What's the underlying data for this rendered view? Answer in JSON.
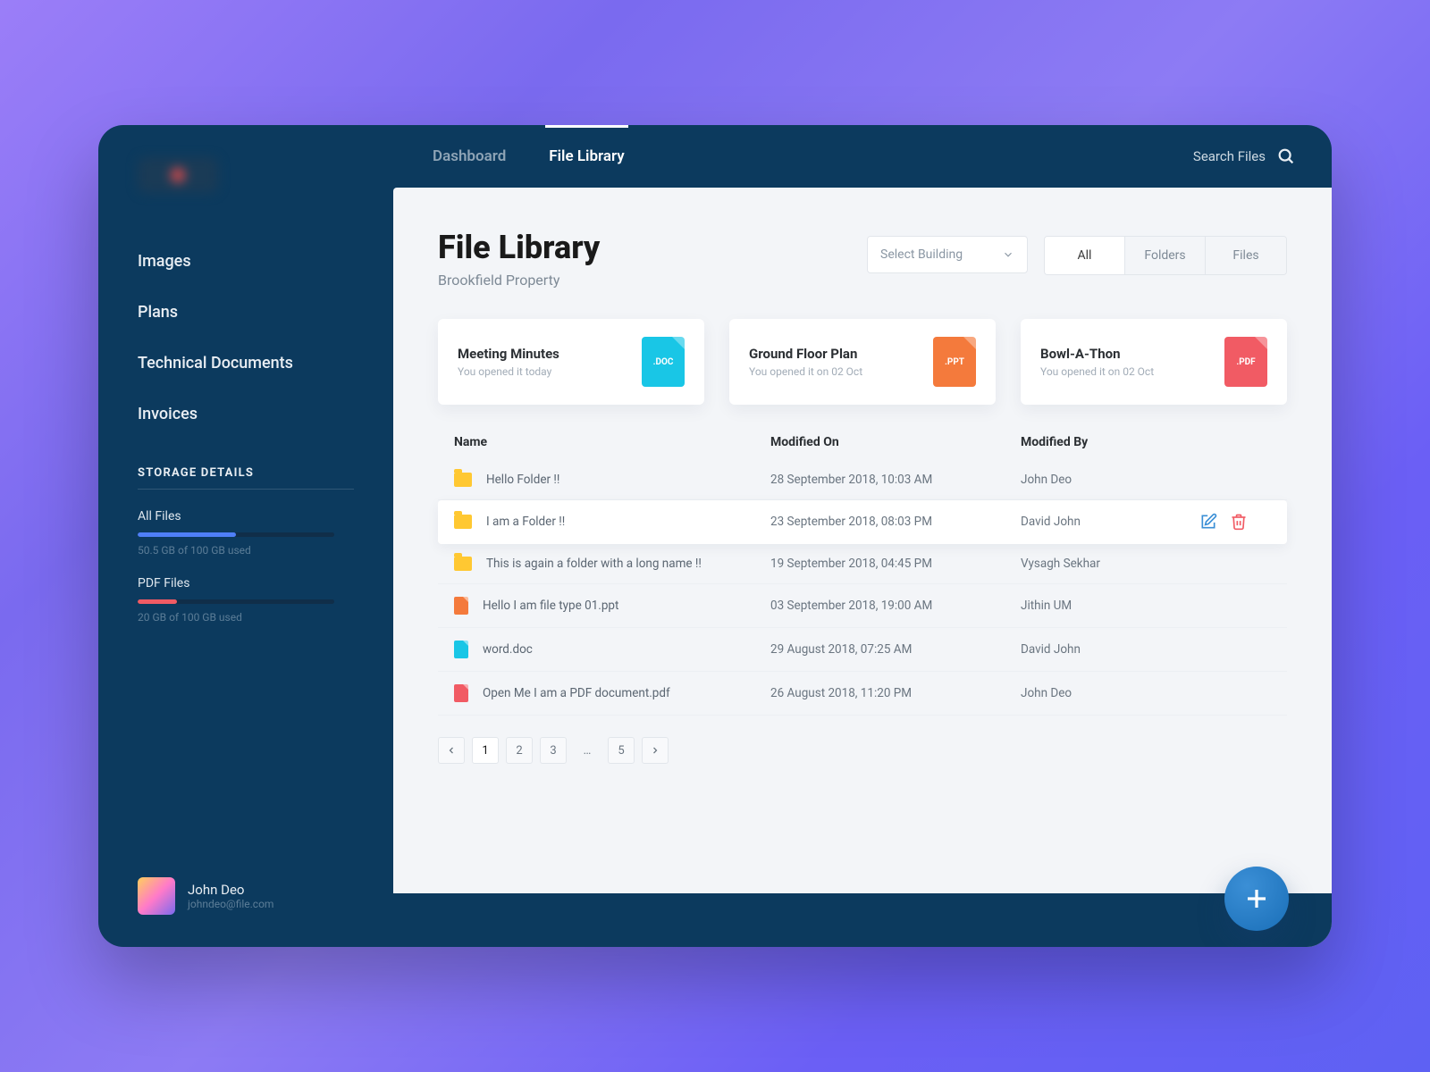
{
  "header": {
    "tabs": [
      {
        "label": "Dashboard",
        "active": false
      },
      {
        "label": "File Library",
        "active": true
      }
    ],
    "search_label": "Search Files"
  },
  "sidebar": {
    "nav": [
      {
        "label": "Images"
      },
      {
        "label": "Plans"
      },
      {
        "label": "Technical Documents"
      },
      {
        "label": "Invoices"
      }
    ],
    "storage_title": "STORAGE DETAILS",
    "storage": [
      {
        "label": "All Files",
        "meta": "50.5 GB of 100 GB used",
        "fill_pct": 50,
        "color": "#4f7ff7"
      },
      {
        "label": "PDF Files",
        "meta": "20 GB of 100 GB used",
        "fill_pct": 20,
        "color": "#f15b64"
      }
    ],
    "user": {
      "name": "John Deo",
      "email": "johndeo@file.com"
    }
  },
  "page": {
    "title": "File Library",
    "subtitle": "Brookfield Property",
    "select_placeholder": "Select Building",
    "filter_tabs": [
      {
        "label": "All",
        "active": true
      },
      {
        "label": "Folders",
        "active": false
      },
      {
        "label": "Files",
        "active": false
      }
    ]
  },
  "recent": [
    {
      "title": "Meeting Minutes",
      "sub": "You opened it today",
      "badge": ".DOC",
      "badge_class": "badge-doc"
    },
    {
      "title": "Ground Floor Plan",
      "sub": "You opened it on 02 Oct",
      "badge": ".PPT",
      "badge_class": "badge-ppt"
    },
    {
      "title": "Bowl-A-Thon",
      "sub": "You opened it on 02 Oct",
      "badge": ".PDF",
      "badge_class": "badge-pdf"
    }
  ],
  "columns": {
    "name": "Name",
    "modified_on": "Modified On",
    "modified_by": "Modified By"
  },
  "rows": [
    {
      "kind": "folder",
      "name": "Hello Folder !!",
      "modified_on": "28 September 2018, 10:03 AM",
      "modified_by": "John Deo",
      "selected": false
    },
    {
      "kind": "folder",
      "name": "I am a Folder !!",
      "modified_on": "23 September 2018, 08:03 PM",
      "modified_by": "David John",
      "selected": true
    },
    {
      "kind": "folder",
      "name": "This is again a folder with a long name !!",
      "modified_on": "19 September 2018, 04:45 PM",
      "modified_by": "Vysagh Sekhar",
      "selected": false
    },
    {
      "kind": "ppt",
      "name": "Hello I am file type 01.ppt",
      "modified_on": "03 September 2018, 19:00 AM",
      "modified_by": "Jithin UM",
      "selected": false
    },
    {
      "kind": "doc",
      "name": "word.doc",
      "modified_on": "29 August 2018, 07:25 AM",
      "modified_by": "David John",
      "selected": false
    },
    {
      "kind": "pdf",
      "name": "Open Me I am a PDF document.pdf",
      "modified_on": "26 August 2018, 11:20 PM",
      "modified_by": "John Deo",
      "selected": false
    }
  ],
  "pagination": {
    "pages": [
      "1",
      "2",
      "3",
      "…",
      "5"
    ],
    "active_index": 0
  }
}
